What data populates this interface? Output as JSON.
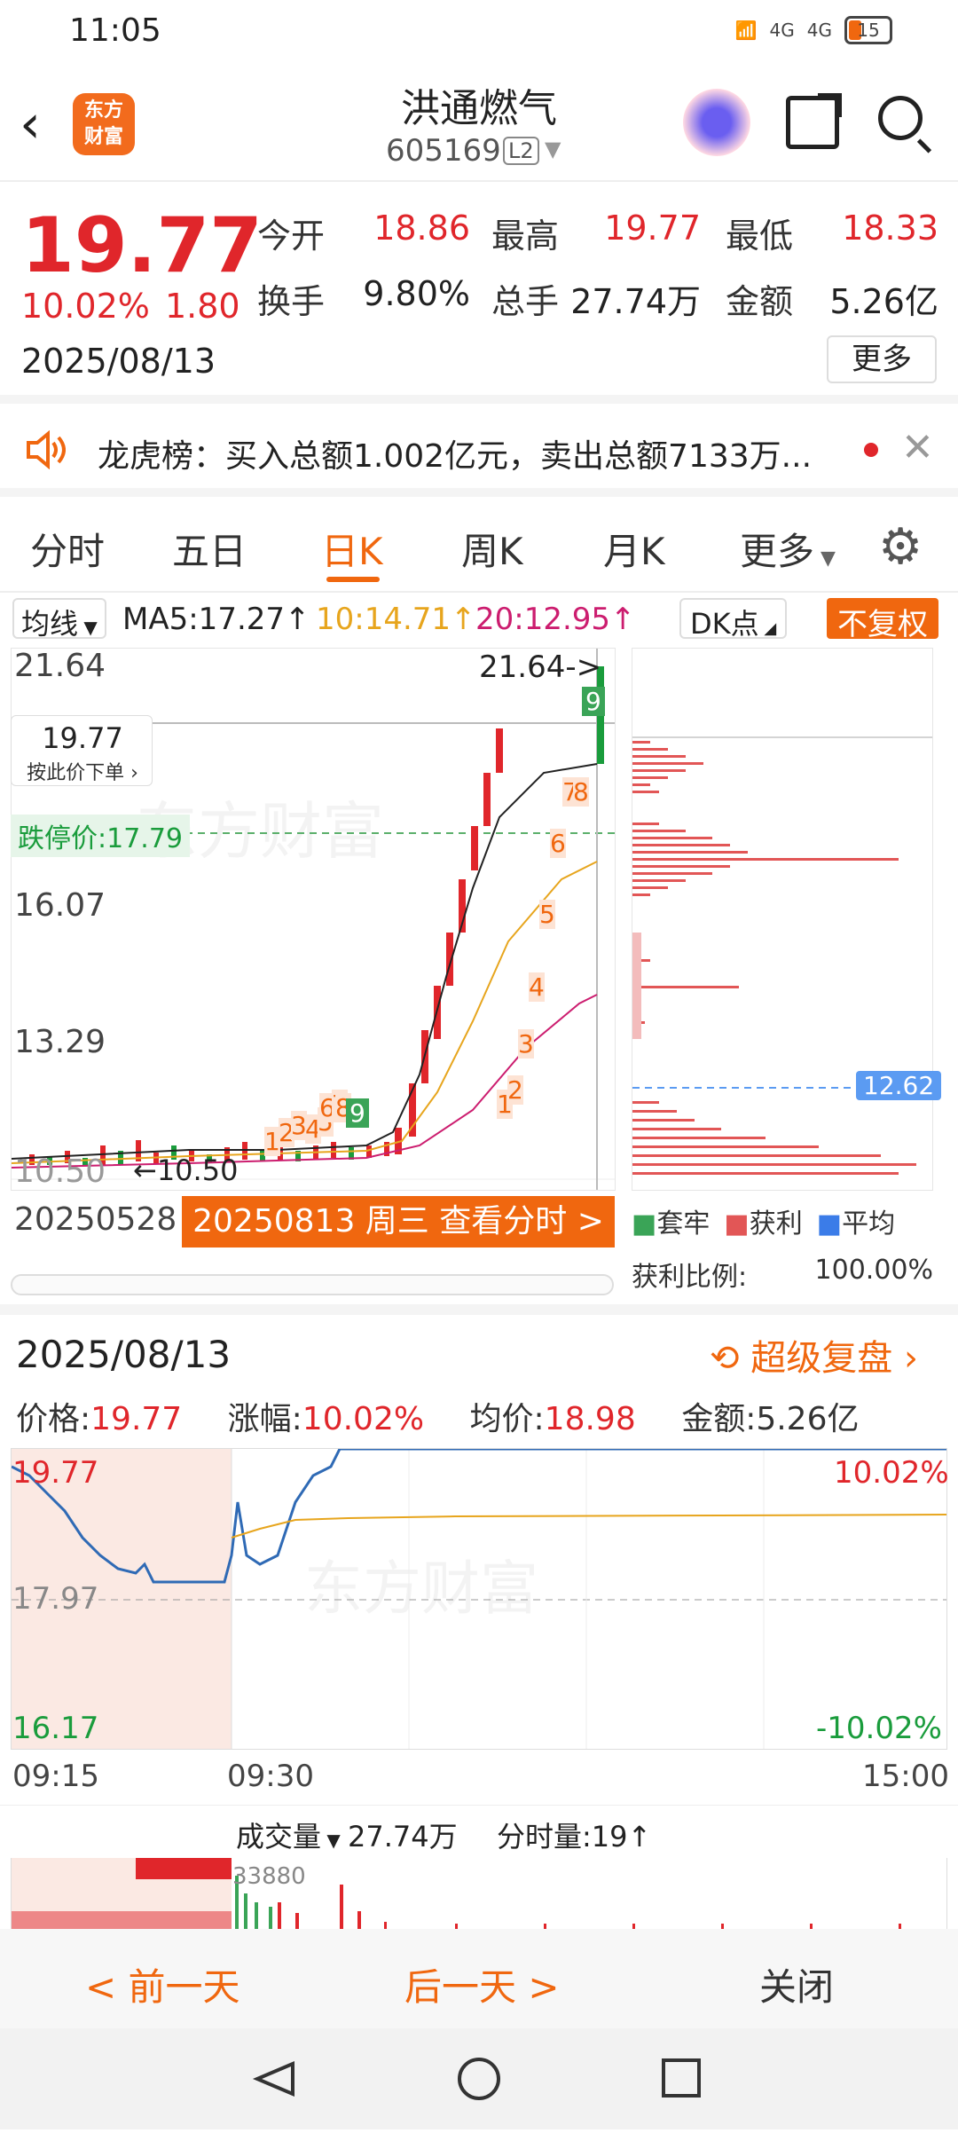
{
  "status": {
    "time": "11:05",
    "net1": "4G",
    "net2": "4G",
    "battery": "15"
  },
  "header": {
    "logo_line1": "东方",
    "logo_line2": "财富",
    "name": "洪通燃气",
    "code": "605169",
    "level": "L2"
  },
  "quote": {
    "price": "19.77",
    "pct": "10.02%",
    "change": "1.80",
    "date": "2025/08/13",
    "open_label": "今开",
    "open": "18.86",
    "high_label": "最高",
    "high": "19.77",
    "low_label": "最低",
    "low": "18.33",
    "turnover_label": "换手",
    "turnover": "9.80%",
    "volume_label": "总手",
    "volume": "27.74万",
    "amount_label": "金额",
    "amount": "5.26亿",
    "more": "更多"
  },
  "notice": {
    "text": "龙虎榜：买入总额1.002亿元，卖出总额7133万..."
  },
  "tabs": [
    "分时",
    "五日",
    "日K",
    "周K",
    "月K",
    "更多"
  ],
  "chart_toolbar": {
    "ma_select": "均线",
    "ma5": "MA5:17.27↑",
    "ma10": "10:14.71↑",
    "ma20": "20:12.95↑",
    "dk": "DK点",
    "adjust": "不复权"
  },
  "kline": {
    "y_labels": [
      "21.64",
      "16.07",
      "13.29",
      "10.50"
    ],
    "top_marker": "21.64->",
    "low_marker": "←10.50",
    "tooltip_price": "19.77",
    "tooltip_hint": "按此价下单",
    "limit_down": "跌停价:17.79",
    "bottom_left": "20250528",
    "bottom_button": "20250813 周三 查看分时 >",
    "seq_labels": [
      "1",
      "2",
      "3",
      "4",
      "5",
      "6",
      "7",
      "8",
      "9",
      "1",
      "2",
      "3",
      "4",
      "5",
      "6",
      "7",
      "8",
      "9"
    ]
  },
  "chip": {
    "legend_hold": "套牢",
    "legend_profit": "获利",
    "legend_avg": "平均",
    "ratio_label": "获利比例:",
    "ratio": "100.00%",
    "avg_price": "12.62"
  },
  "intraday": {
    "date": "2025/08/13",
    "super": "超级复盘",
    "price_label": "价格:",
    "price": "19.77",
    "pct_label": "涨幅:",
    "pct": "10.02%",
    "avg_label": "均价:",
    "avg": "18.98",
    "amount_label": "金额:",
    "amount": "5.26亿",
    "y_top": "19.77",
    "y_mid": "17.97",
    "y_bot": "16.17",
    "r_top": "10.02%",
    "r_bot": "-10.02%",
    "times": [
      "09:15",
      "09:30",
      "15:00"
    ]
  },
  "volume": {
    "select": "成交量",
    "value": "27.74万",
    "time_label": "分时量:19↑",
    "peak": "33880"
  },
  "actions": {
    "prev": "< 前一天",
    "next": "后一天 >",
    "close": "关闭"
  },
  "colors": {
    "up": "#e0262b",
    "down": "#1a9c3c",
    "accent": "#f0670f",
    "avg_line": "#5b9bf2"
  }
}
